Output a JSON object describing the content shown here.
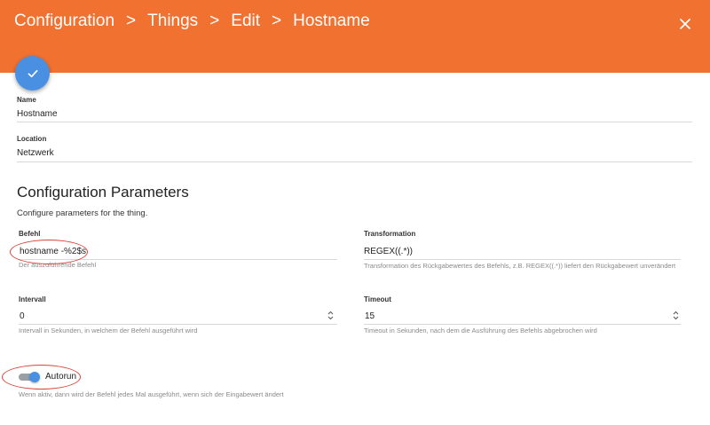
{
  "header": {
    "breadcrumb": [
      "Configuration",
      "Things",
      "Edit",
      "Hostname"
    ],
    "separator": ">",
    "close_icon": "close-icon",
    "background": "#f07130"
  },
  "save_fab": {
    "icon": "check-icon",
    "color": "#4a90e2"
  },
  "fields": {
    "name": {
      "label": "Name",
      "value": "Hostname"
    },
    "location": {
      "label": "Location",
      "value": "Netzwerk"
    }
  },
  "configuration": {
    "title": "Configuration Parameters",
    "description": "Configure parameters for the thing.",
    "befehl": {
      "label": "Befehl",
      "value": "hostname -%2$s",
      "hint": "Der auszuführende Befehl"
    },
    "transformation": {
      "label": "Transformation",
      "value": "REGEX((.*))",
      "hint": "Transformation des Rückgabewertes des Befehls, z.B. REGEX((.*)) liefert den Rückgabewert unverändert"
    },
    "intervall": {
      "label": "Intervall",
      "value": "0",
      "hint": "Intervall in Sekunden, in welchem der Befehl ausgeführt wird"
    },
    "timeout": {
      "label": "Timeout",
      "value": "15",
      "hint": "Timeout in Sekunden, nach dem die Ausführung des Befehls abgebrochen wird"
    },
    "autorun": {
      "label": "Autorun",
      "enabled": true,
      "hint": "Wenn aktiv, dann wird der Befehl jedes Mal ausgeführt, wenn sich der Eingabewert ändert"
    }
  },
  "annotation_color": "#d9443a"
}
